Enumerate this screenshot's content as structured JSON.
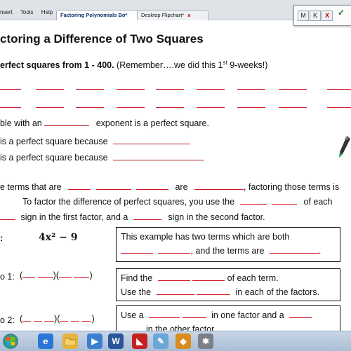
{
  "menu": [
    "nsert",
    "Tools",
    "Help"
  ],
  "tabs": [
    {
      "label": "Factoring Polynomials Bo*",
      "active": true
    },
    {
      "label": "Desktop Flipchart*",
      "active": false
    }
  ],
  "tab_close": "x",
  "float_toolbar": {
    "m_label": "M",
    "k_label": "K",
    "x_label": "X",
    "check_label": "✓"
  },
  "title": "ctoring a Difference of Two Squares",
  "subtitle_bold": "erfect squares from 1 - 400.",
  "subtitle_rest_before": "  (Remember….we did this 1",
  "subtitle_sup": "st",
  "subtitle_rest_after": " 9-weeks!)",
  "line_exponent": {
    "pre": "ble with an",
    "post": "exponent is a perfect square."
  },
  "line_because1": "is a perfect square because",
  "line_because2": "is a perfect square because",
  "para1": {
    "a": "e terms that are",
    "b": "are",
    "c": ", factoring those terms is"
  },
  "para2": {
    "a": "To factor the difference of perfect squares, you use the",
    "b": "of each"
  },
  "para3": {
    "a": "sign in the first factor, and a",
    "b": "sign in the second factor."
  },
  "example_label": ":",
  "example_expr": "4x² − 9",
  "box1": {
    "line1": "This example has two terms which are both",
    "line2_post": ", and the terms are",
    "end": "."
  },
  "step1_label": "o 1:",
  "step1_parens": "(__ __)(__ __)",
  "box2": {
    "line1_pre": "Find the",
    "line1_post": "of each term.",
    "line2_pre": "Use the",
    "line2_post": "in each of the factors."
  },
  "step2_label": "o 2:",
  "step2_parens": "(__ __ __)(__ __ __)",
  "box3": {
    "line1_pre": "Use a",
    "line1_mid": "in one factor and a",
    "line2": "in the other factor"
  },
  "taskbar_icons": [
    "start-icon",
    "ie-icon",
    "folder-icon",
    "media-player-icon",
    "word-icon",
    "pdf-icon",
    "paint-icon",
    "flipchart-icon",
    "tools-icon"
  ]
}
